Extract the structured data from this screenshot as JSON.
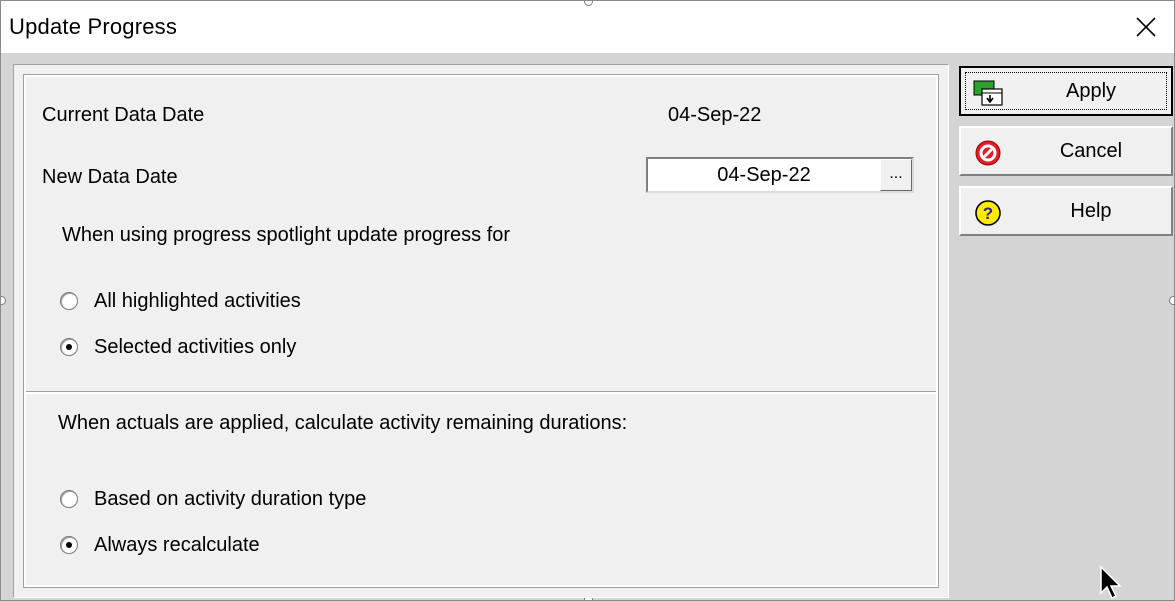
{
  "window": {
    "title": "Update Progress"
  },
  "dates": {
    "current_label": "Current Data Date",
    "current_value": "04-Sep-22",
    "new_label": "New Data Date",
    "new_value": "04-Sep-22",
    "browse_label": "..."
  },
  "spotlight": {
    "heading": "When using progress spotlight update progress for",
    "options": [
      {
        "label": "All highlighted activities",
        "selected": false
      },
      {
        "label": "Selected activities only",
        "selected": true
      }
    ]
  },
  "durations": {
    "heading": "When actuals are applied, calculate activity remaining durations:",
    "options": [
      {
        "label": "Based on activity duration type",
        "selected": false
      },
      {
        "label": "Always recalculate",
        "selected": true
      }
    ]
  },
  "buttons": {
    "apply": "Apply",
    "cancel": "Cancel",
    "help": "Help"
  },
  "icons": {
    "apply": "apply-icon",
    "cancel": "cancel-icon",
    "help": "help-icon",
    "close": "close-icon"
  },
  "colors": {
    "dialog_bg": "#d4d4d4",
    "panel_bg": "#f0f0f0",
    "cancel_red": "#e21e26",
    "help_yellow": "#ffeb00",
    "apply_green": "#2ca02c"
  }
}
